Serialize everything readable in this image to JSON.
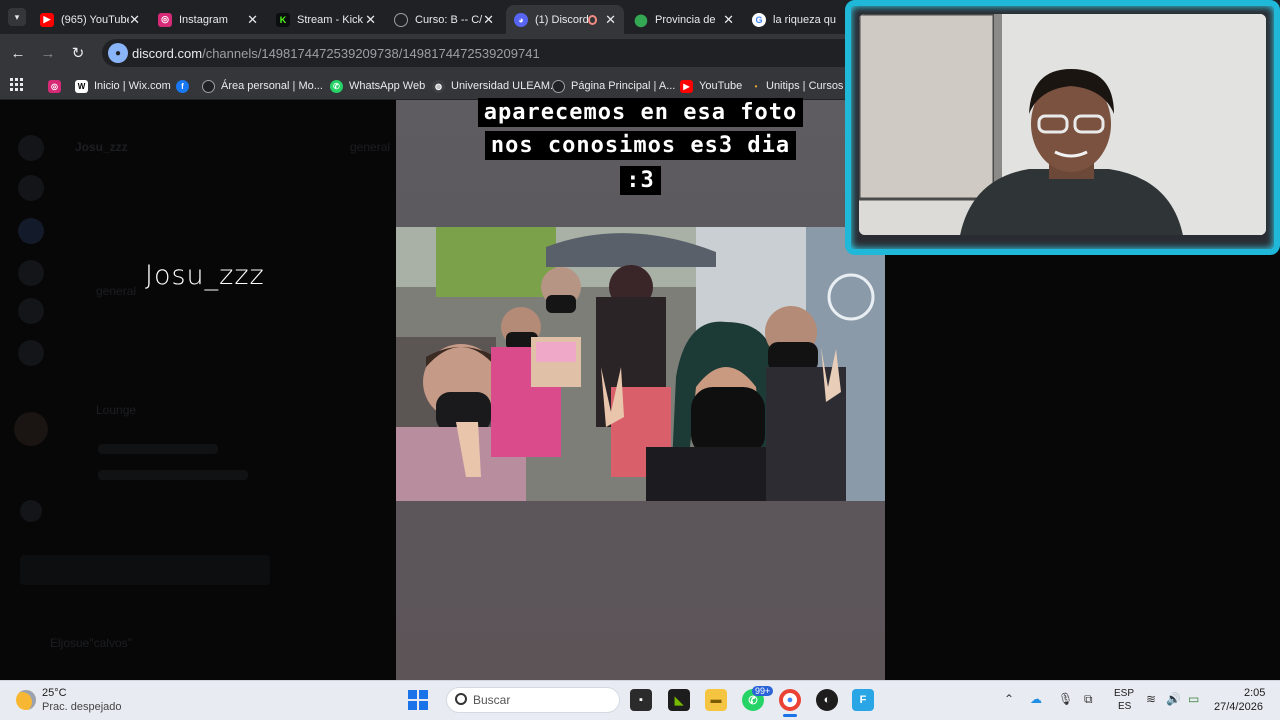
{
  "tabs": [
    {
      "title": "(965) YouTube",
      "icon": "youtube-icon",
      "color": "#ff0000"
    },
    {
      "title": "Instagram",
      "icon": "instagram-icon",
      "color": "#d62976"
    },
    {
      "title": "Stream - Kick",
      "icon": "kick-icon",
      "color": "#53fc18"
    },
    {
      "title": "Curso: B -- C/",
      "icon": "globe-icon",
      "color": "#5f6368"
    },
    {
      "title": "(1) Discord",
      "icon": "discord-icon",
      "color": "#5865f2"
    },
    {
      "title": "Provincia de",
      "icon": "maps-pin-icon",
      "color": "#34a853"
    },
    {
      "title": "la riqueza qu",
      "icon": "google-icon",
      "color": "#4285f4"
    }
  ],
  "address": {
    "domain": "discord.com",
    "path": "/channels/1498174472539209738/1498174472539209741"
  },
  "bookmarks": [
    {
      "label": "",
      "icon": "instagram-icon"
    },
    {
      "label": "Inicio | Wix.com",
      "icon": "wix-icon"
    },
    {
      "label": "",
      "icon": "facebook-icon"
    },
    {
      "label": "Área personal | Mo...",
      "icon": "moodle-icon"
    },
    {
      "label": "WhatsApp Web",
      "icon": "whatsapp-icon"
    },
    {
      "label": "Universidad ULEAM.",
      "icon": "globe-icon"
    },
    {
      "label": "Página Principal | A...",
      "icon": "page-icon"
    },
    {
      "label": "YouTube",
      "icon": "youtube-icon"
    },
    {
      "label": "Unitips | Cursos pa",
      "icon": "unitips-icon"
    }
  ],
  "discord": {
    "server_name": "Josu_zzz",
    "channel_header": "general",
    "channel_general": "general",
    "voice_channel": "Lounge",
    "user_name": "Eljosue\"calvos\"",
    "overlay_name": "Josu_zzz"
  },
  "viewer": {
    "caption_lines": [
      "aparecemos en esa foto",
      "nos conosimos es3 dia",
      ":3"
    ]
  },
  "taskbar": {
    "temperature": "25°C",
    "weather": "Prac. despejado",
    "search_placeholder": "Buscar",
    "whatsapp_badge": "99+",
    "lang_top": "ESP",
    "lang_bottom": "ES",
    "time": "2:05",
    "date": "27/4/2026"
  }
}
